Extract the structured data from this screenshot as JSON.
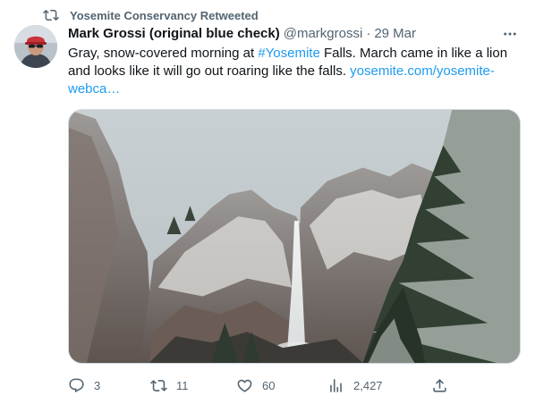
{
  "retweet_banner": {
    "icon": "retweet-icon",
    "text": "Yosemite Conservancy Retweeted"
  },
  "tweet": {
    "author": {
      "display_name": "Mark Grossi (original blue check)",
      "handle": "@markgrossi",
      "avatar_icon": "avatar"
    },
    "separator": "·",
    "date": "29 Mar",
    "text": {
      "part1": "Gray, snow-covered morning at ",
      "hashtag": "#Yosemite",
      "part2": " Falls. March came in like a lion and looks like it will go out roaring like the falls. ",
      "link": "yosemite.com/yosemite-webca…"
    },
    "media": {
      "icon": "yosemite-falls-photo"
    },
    "actions": {
      "replies": "3",
      "retweets": "11",
      "likes": "60",
      "views": "2,427"
    }
  },
  "colors": {
    "text_primary": "#0f1419",
    "text_secondary": "#536471",
    "link": "#1d9bf0",
    "border": "#cfd9de"
  }
}
